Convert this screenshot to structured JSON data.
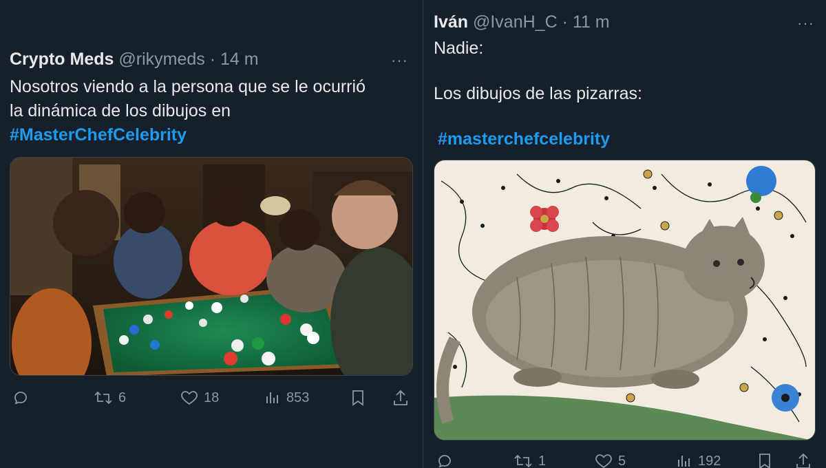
{
  "left_tweet": {
    "author_name": "Crypto Meds",
    "handle": "@rikymeds",
    "separator": "·",
    "time": "14 m",
    "more_label": "···",
    "text_lines": [
      "Nosotros viendo a la persona que se le ocurrió",
      "la dinámica de los dibujos en"
    ],
    "hashtag": "#MasterChefCelebrity",
    "image_icon": "poker-table-photo",
    "actions": {
      "replies": "",
      "retweets": "6",
      "likes": "18",
      "views": "853"
    }
  },
  "right_tweet": {
    "author_name": "Iván",
    "handle": "@IvanH_C",
    "separator": "·",
    "time": "11 m",
    "more_label": "···",
    "text_line_1": "Nadie:",
    "text_line_2": "Los dibujos de las pizarras:",
    "hashtag": "#masterchefcelebrity",
    "image_icon": "medieval-cat-illustration",
    "actions": {
      "replies": "",
      "retweets": "1",
      "likes": "5",
      "views": "192"
    }
  },
  "colors": {
    "background": "#15202b",
    "accent": "#1d9bf0",
    "muted": "#8b98a5",
    "text": "#e7e9ea"
  }
}
